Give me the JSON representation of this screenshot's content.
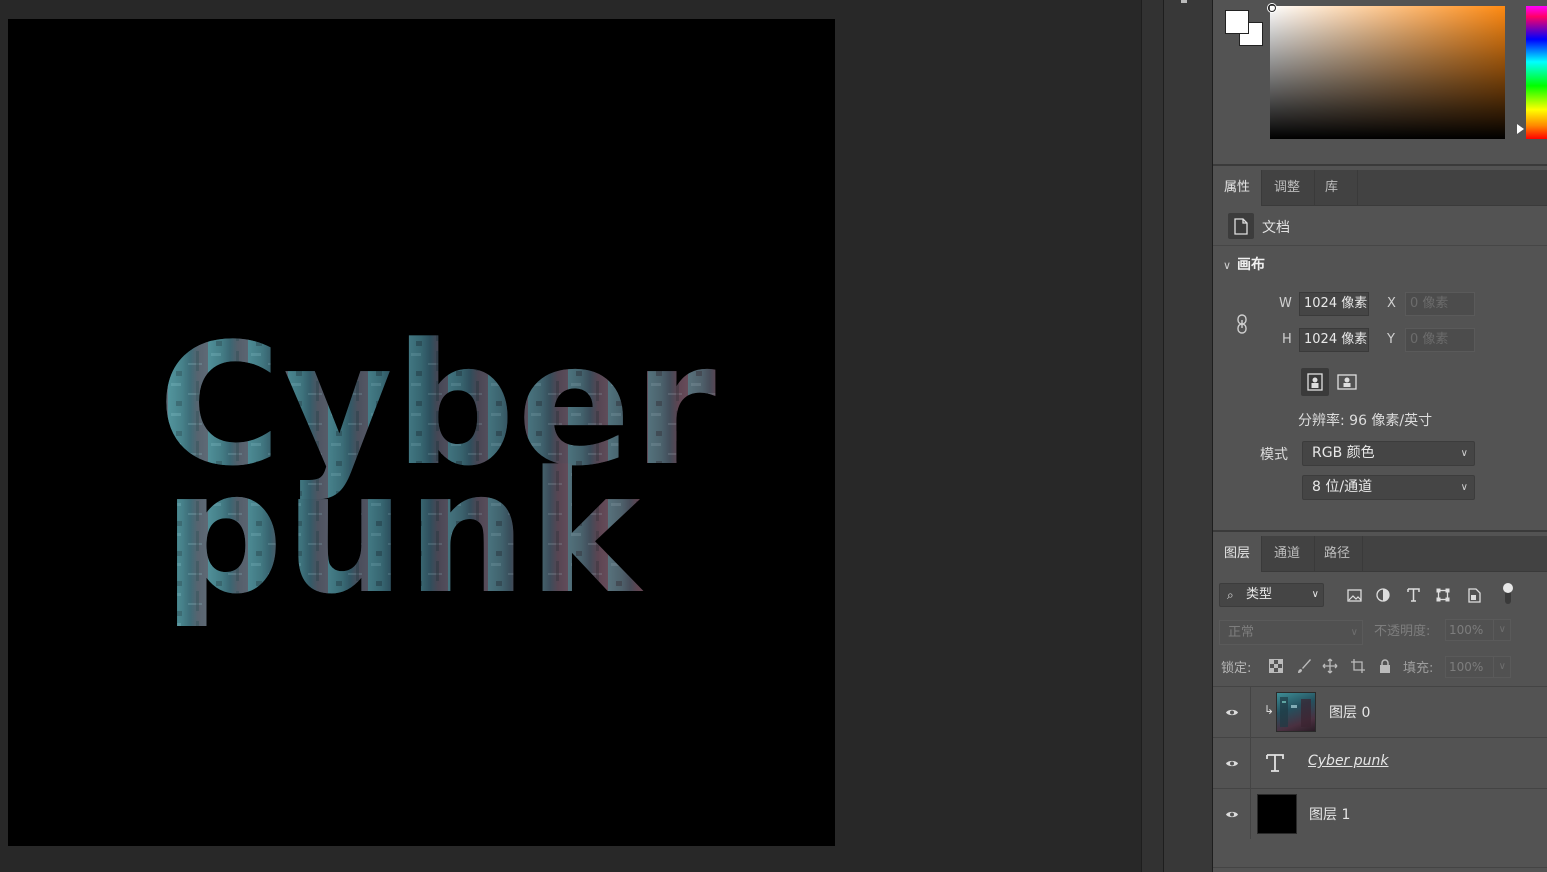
{
  "color_panel": {
    "foreground_color": "#ffffff",
    "background_color": "#ffffff",
    "picker_hue_color": "#ff8a12"
  },
  "canvas": {
    "text_line_1": "Cyber",
    "text_line_2": "punk",
    "background_color": "#000000"
  },
  "properties_tabs": [
    {
      "label": "属性",
      "active": true
    },
    {
      "label": "调整",
      "active": false
    },
    {
      "label": "库",
      "active": false
    }
  ],
  "properties": {
    "doc_label": "文档",
    "section_title": "画布",
    "width_label": "W",
    "width_value": "1024 像素",
    "height_label": "H",
    "height_value": "1024 像素",
    "x_label": "X",
    "x_value": "0 像素",
    "y_label": "Y",
    "y_value": "0 像素",
    "resolution": "分辨率: 96 像素/英寸",
    "mode_label": "模式",
    "mode_value": "RGB 颜色",
    "depth_value": "8 位/通道"
  },
  "layers_tabs": [
    {
      "label": "图层",
      "active": true
    },
    {
      "label": "通道",
      "active": false
    },
    {
      "label": "路径",
      "active": false
    }
  ],
  "layers_panel": {
    "filter_value": "类型",
    "blend_mode": "正常",
    "opacity_label": "不透明度:",
    "opacity_value": "100%",
    "lock_label": "锁定:",
    "fill_label": "填充:",
    "fill_value": "100%"
  },
  "layers": [
    {
      "name": "图层 0",
      "type": "image",
      "clipped": true,
      "visible": true
    },
    {
      "name": "Cyber punk",
      "type": "text",
      "visible": true
    },
    {
      "name": "图层 1",
      "type": "fill",
      "visible": true
    }
  ]
}
